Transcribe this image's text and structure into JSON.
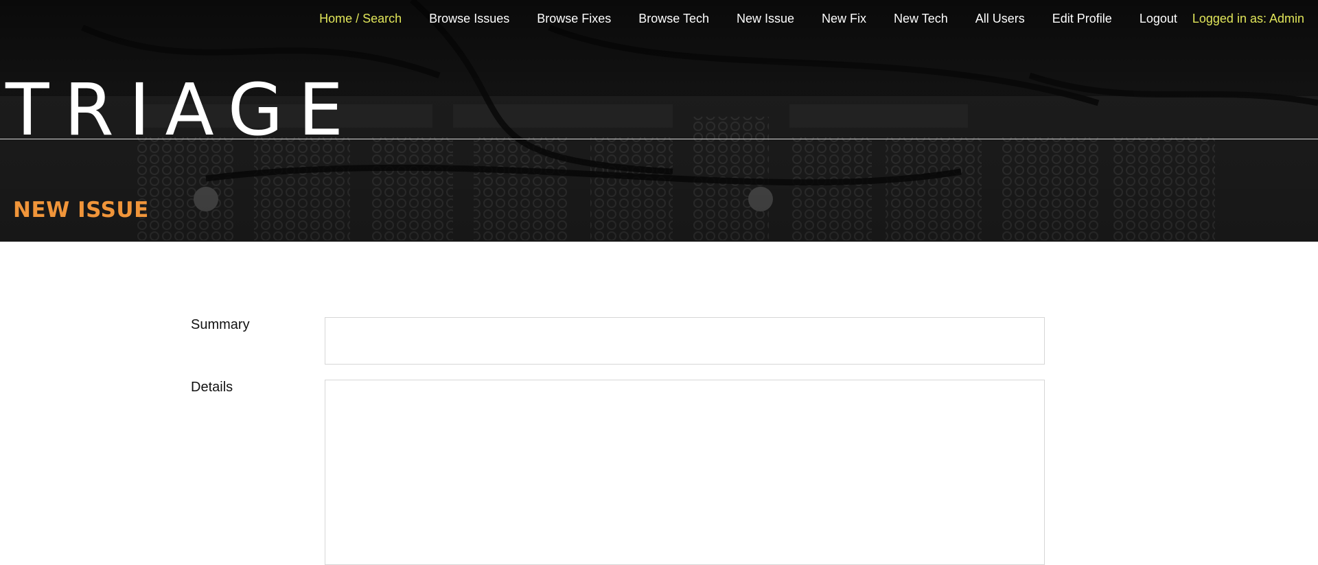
{
  "nav": {
    "items": [
      {
        "label": "Home / Search"
      },
      {
        "label": "Browse Issues"
      },
      {
        "label": "Browse Fixes"
      },
      {
        "label": "Browse Tech"
      },
      {
        "label": "New Issue"
      },
      {
        "label": "New Fix"
      },
      {
        "label": "New Tech"
      },
      {
        "label": "All Users"
      },
      {
        "label": "Edit Profile"
      },
      {
        "label": "Logout"
      }
    ],
    "logged_in": "Logged in as: Admin"
  },
  "brand": "TRIAGE",
  "page_title": "NEW ISSUE",
  "form": {
    "summary_label": "Summary",
    "summary_value": "",
    "details_label": "Details",
    "details_value": ""
  },
  "colors": {
    "accent_nav": "#e1e65a",
    "title": "#f0953a",
    "hero_bg": "#141414"
  }
}
